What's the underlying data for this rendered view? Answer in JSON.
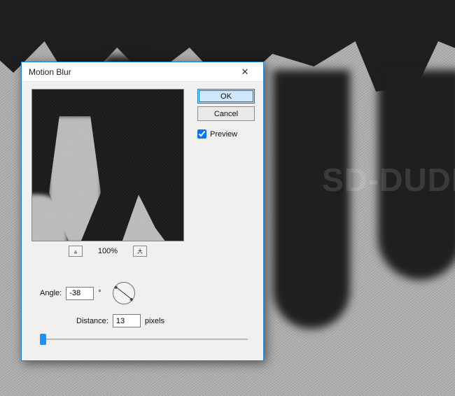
{
  "background": {
    "watermark": "SD-DUDE"
  },
  "dialog": {
    "title": "Motion Blur",
    "close_glyph": "✕",
    "ok_label": "OK",
    "cancel_label": "Cancel",
    "preview_label": "Preview",
    "preview_checked": true,
    "zoom": {
      "minus": "-",
      "plus": "+",
      "level": "100%"
    },
    "angle": {
      "label": "Angle:",
      "value": "-38",
      "unit": "°"
    },
    "distance": {
      "label": "Distance:",
      "value": "13",
      "unit": "pixels"
    }
  }
}
